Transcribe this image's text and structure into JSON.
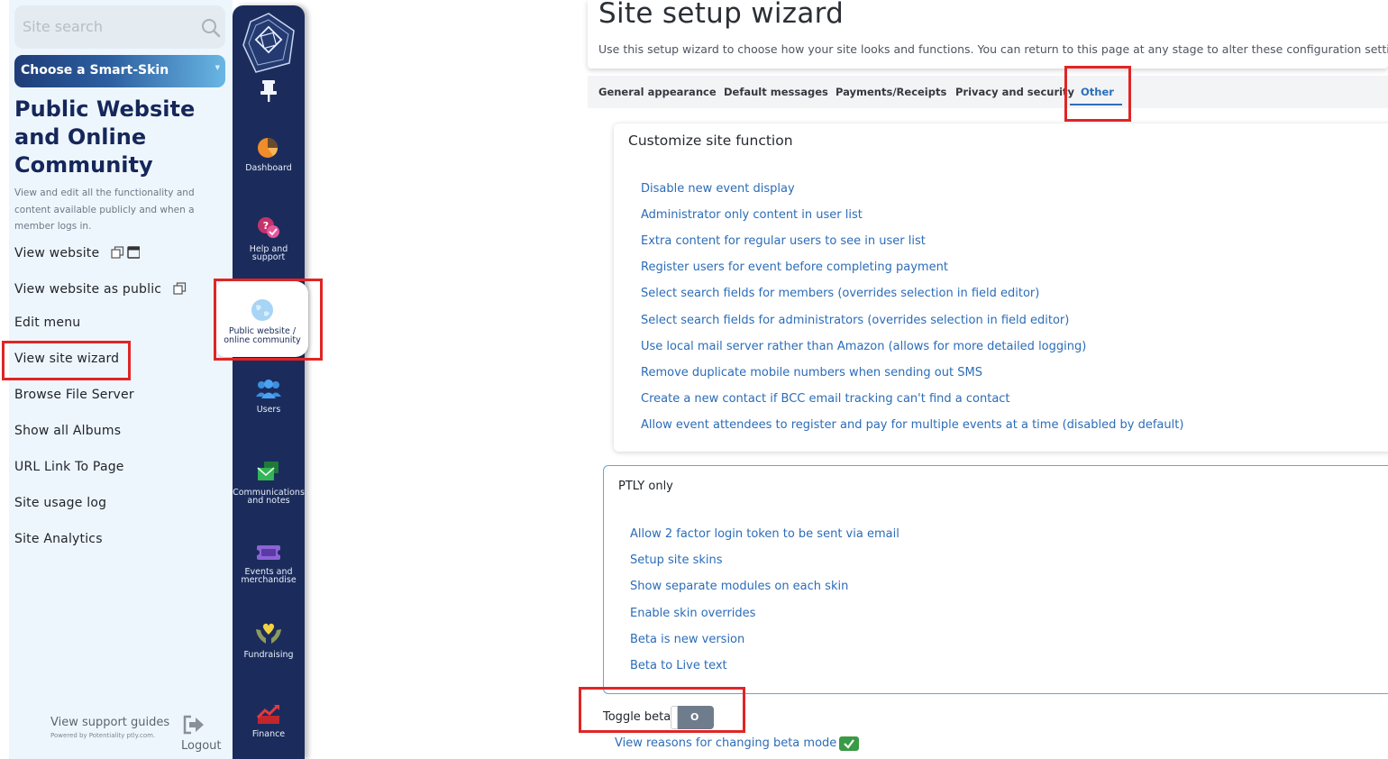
{
  "left_panel": {
    "search_placeholder": "Site search",
    "skin_button": "Choose a Smart-Skin",
    "title": "Public Website and Online Community",
    "description": "View and edit all the functionality and content available publicly and when a member logs in.",
    "menu": [
      {
        "label": "View website",
        "icons": [
          "external-window-icon",
          "browser-window-icon"
        ]
      },
      {
        "label": "View website as public",
        "icons": [
          "external-window-icon"
        ]
      },
      {
        "label": "Edit menu"
      },
      {
        "label": "View site wizard"
      },
      {
        "label": "Browse File Server"
      },
      {
        "label": "Show all Albums"
      },
      {
        "label": "URL Link To Page"
      },
      {
        "label": "Site usage log"
      },
      {
        "label": "Site Analytics"
      }
    ],
    "support_link": "View support guides",
    "powered_by": "Powered by Potentiality ptly.com.",
    "logout": "Logout"
  },
  "side_nav": {
    "items": [
      {
        "label": "Dashboard",
        "icon": "pie-chart-icon"
      },
      {
        "label": "Help and support",
        "icon": "help-chat-icon"
      },
      {
        "label": "Public website / online community",
        "icon": "globe-icon",
        "active": true
      },
      {
        "label": "Users",
        "icon": "users-icon"
      },
      {
        "label": "Communications and notes",
        "icon": "envelope-icon"
      },
      {
        "label": "Events and merchandise",
        "icon": "ticket-icon"
      },
      {
        "label": "Fundraising",
        "icon": "heart-hands-icon"
      },
      {
        "label": "Finance",
        "icon": "trend-up-icon"
      }
    ]
  },
  "header": {
    "title": "Site setup wizard",
    "subtitle": "Use this setup wizard to choose how your site looks and functions. You can return to this page at any stage to alter these configuration settings."
  },
  "tabs": [
    {
      "label": "General appearance"
    },
    {
      "label": "Default messages"
    },
    {
      "label": "Payments/Receipts"
    },
    {
      "label": "Privacy and security"
    },
    {
      "label": "Other",
      "active": true
    }
  ],
  "customize": {
    "heading": "Customize site function",
    "links": [
      "Disable new event display",
      "Administrator only content in user list",
      "Extra content for regular users to see in user list",
      "Register users for event before completing payment",
      "Select search fields for members (overrides selection in field editor)",
      "Select search fields for administrators (overrides selection in field editor)",
      "Use local mail server rather than Amazon (allows for more detailed logging)",
      "Remove duplicate mobile numbers when sending out SMS",
      "Create a new contact if BCC email tracking can't find a contact",
      "Allow event attendees to register and pay for multiple events at a time (disabled by default)"
    ]
  },
  "ptly": {
    "heading": "PTLY only",
    "links": [
      "Allow 2 factor login token to be sent via email",
      "Setup site skins",
      "Show separate modules on each skin",
      "Enable skin overrides",
      "Beta is new version",
      "Beta to Live text"
    ]
  },
  "beta": {
    "label": "Toggle beta:",
    "state": "O",
    "reasons_link": "View reasons for changing beta mode"
  },
  "colors": {
    "nav_bg": "#1b2c5c",
    "link": "#2b6cb8",
    "highlight": "#e02525",
    "panel_bg": "#eef6fd"
  }
}
